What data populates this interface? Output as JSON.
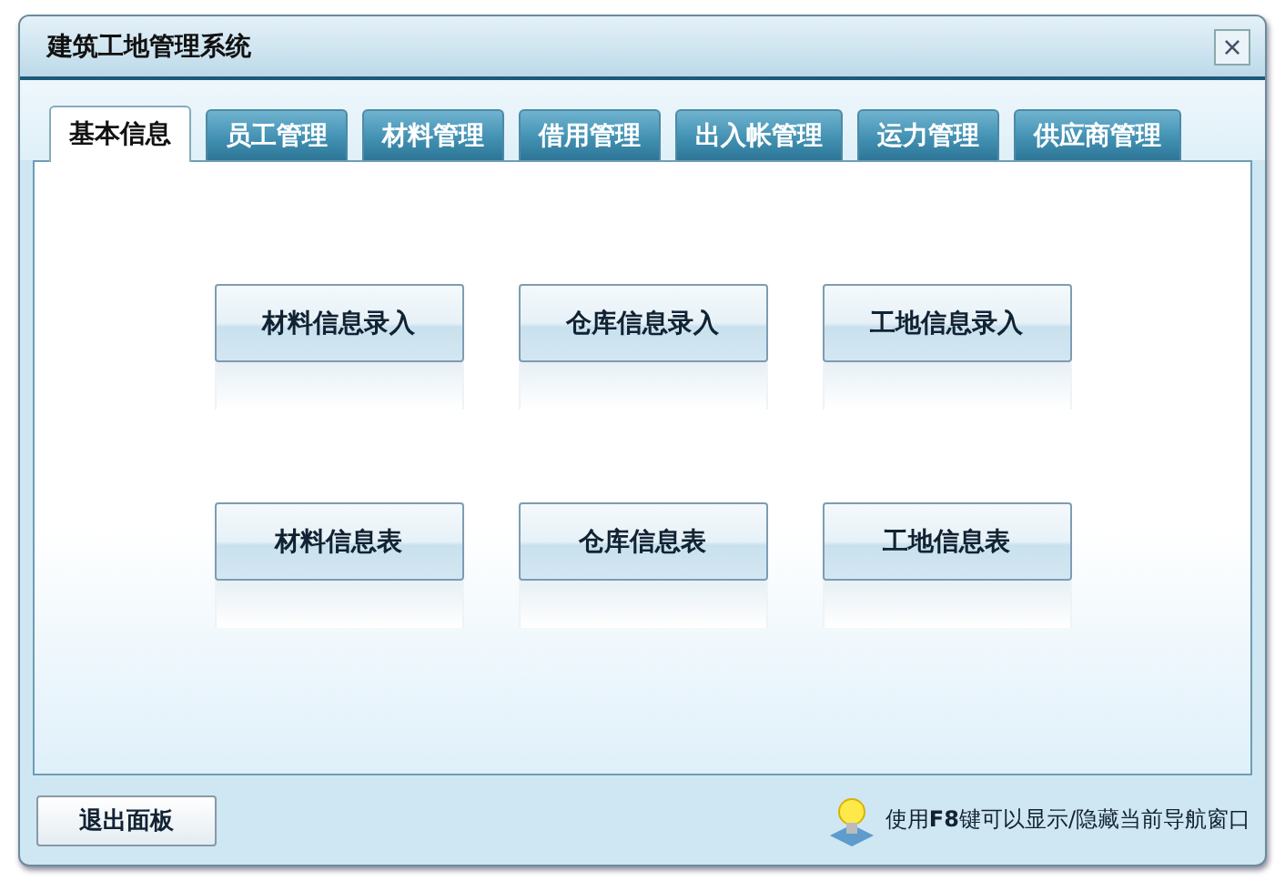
{
  "window": {
    "title": "建筑工地管理系统",
    "close": "×"
  },
  "tabs": [
    {
      "label": "基本信息",
      "selected": true
    },
    {
      "label": "员工管理",
      "selected": false
    },
    {
      "label": "材料管理",
      "selected": false
    },
    {
      "label": "借用管理",
      "selected": false
    },
    {
      "label": "出入帐管理",
      "selected": false
    },
    {
      "label": "运力管理",
      "selected": false
    },
    {
      "label": "供应商管理",
      "selected": false
    }
  ],
  "buttons": [
    {
      "label": "材料信息录入"
    },
    {
      "label": "仓库信息录入"
    },
    {
      "label": "工地信息录入"
    },
    {
      "label": "材料信息表"
    },
    {
      "label": "仓库信息表"
    },
    {
      "label": "工地信息表"
    }
  ],
  "footer": {
    "exit_button": "退出面板",
    "hint": "使用**F8**键可以显示/隐藏当前导航窗口"
  }
}
